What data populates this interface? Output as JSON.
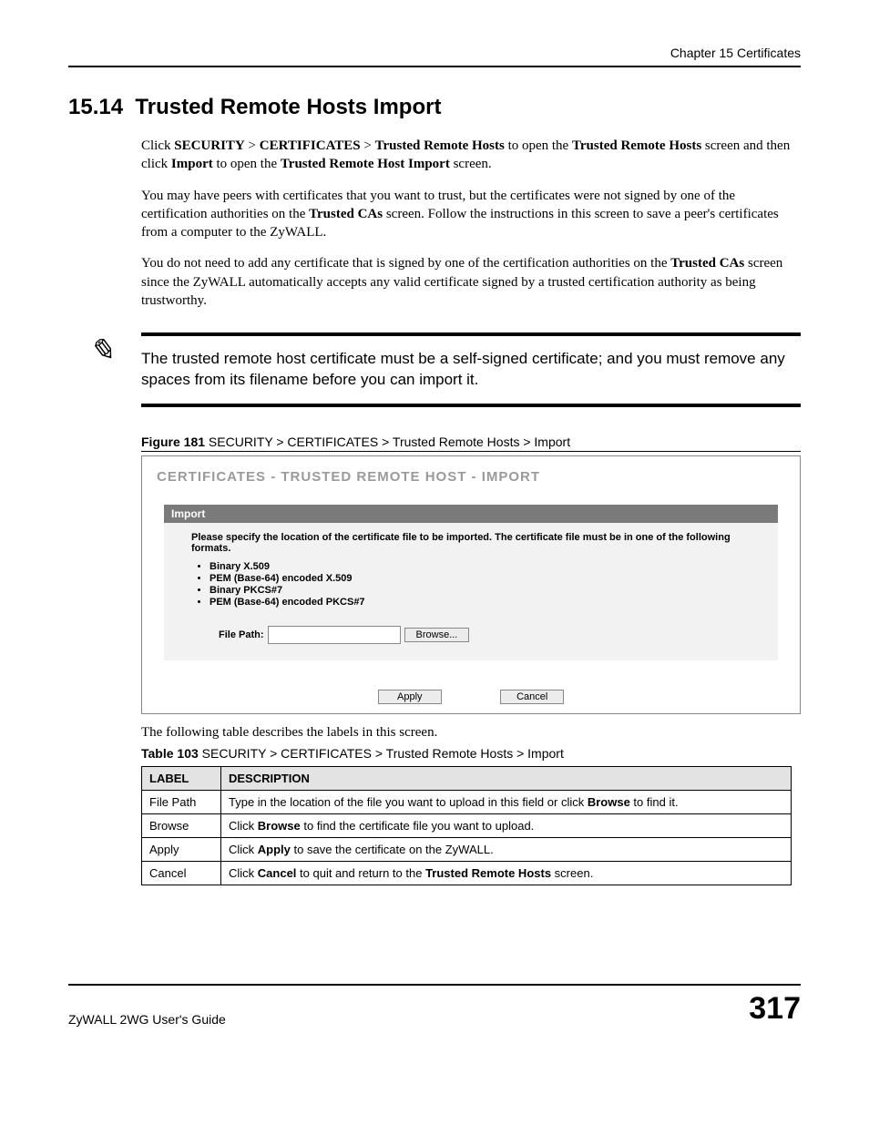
{
  "chapter": "Chapter 15 Certificates",
  "section_number": "15.14",
  "section_title": "Trusted Remote Hosts Import",
  "para1_prefix": "Click ",
  "para1_b1": "SECURITY",
  "para1_gt1": " > ",
  "para1_b2": "CERTIFICATES",
  "para1_gt2": " > ",
  "para1_b3": "Trusted Remote Hosts",
  "para1_mid1": " to open the ",
  "para1_b4": "Trusted Remote Hosts",
  "para1_mid2": " screen and then click ",
  "para1_b5": "Import",
  "para1_mid3": " to open the ",
  "para1_b6": "Trusted Remote Host Import",
  "para1_end": " screen.",
  "para2_a": "You may have peers with certificates that you want to trust, but the certificates were not signed by one of the certification authorities on the ",
  "para2_b": "Trusted CAs",
  "para2_c": " screen. Follow the instructions in this screen to save a peer's certificates from a computer to the ZyWALL.",
  "para3_a": "You do not need to add any certificate that is signed by one of the certification authorities on the ",
  "para3_b": "Trusted CAs",
  "para3_c": " screen since the ZyWALL automatically accepts any valid certificate signed by a trusted certification authority as being trustworthy.",
  "note_text": "The trusted remote host certificate must be a self-signed certificate; and you must remove any spaces from its filename before you can import it.",
  "figure_num": "Figure 181",
  "figure_title": "   SECURITY > CERTIFICATES > Trusted Remote Hosts > Import",
  "screenshot": {
    "title": "CERTIFICATES - TRUSTED REMOTE HOST - IMPORT",
    "panel_header": "Import",
    "instruction": "Please specify the location of the certificate file to be imported. The certificate file must be in one of the following formats.",
    "formats": [
      "Binary X.509",
      "PEM (Base-64) encoded X.509",
      "Binary PKCS#7",
      "PEM (Base-64) encoded PKCS#7"
    ],
    "file_path_label": "File Path:",
    "browse_btn": "Browse...",
    "apply_btn": "Apply",
    "cancel_btn": "Cancel"
  },
  "after_figure_text": "The following table describes the labels in this screen.",
  "table_num": "Table 103",
  "table_title": "   SECURITY > CERTIFICATES > Trusted Remote Hosts > Import",
  "table": {
    "headers": [
      "LABEL",
      "DESCRIPTION"
    ],
    "rows": [
      {
        "label": "File Path",
        "desc_a": "Type in the location of the file you want to upload in this field or click ",
        "desc_b": "Browse",
        "desc_c": " to find it."
      },
      {
        "label": "Browse",
        "desc_a": "Click ",
        "desc_b": "Browse",
        "desc_c": " to find the certificate file you want to upload."
      },
      {
        "label": "Apply",
        "desc_a": "Click ",
        "desc_b": "Apply",
        "desc_c": " to save the certificate on the ZyWALL."
      },
      {
        "label": "Cancel",
        "desc_a": "Click ",
        "desc_b": "Cancel",
        "desc_c": " to quit and return to the ",
        "desc_d": "Trusted Remote Hosts",
        "desc_e": " screen."
      }
    ]
  },
  "footer_guide": "ZyWALL 2WG User's Guide",
  "page_number": "317"
}
